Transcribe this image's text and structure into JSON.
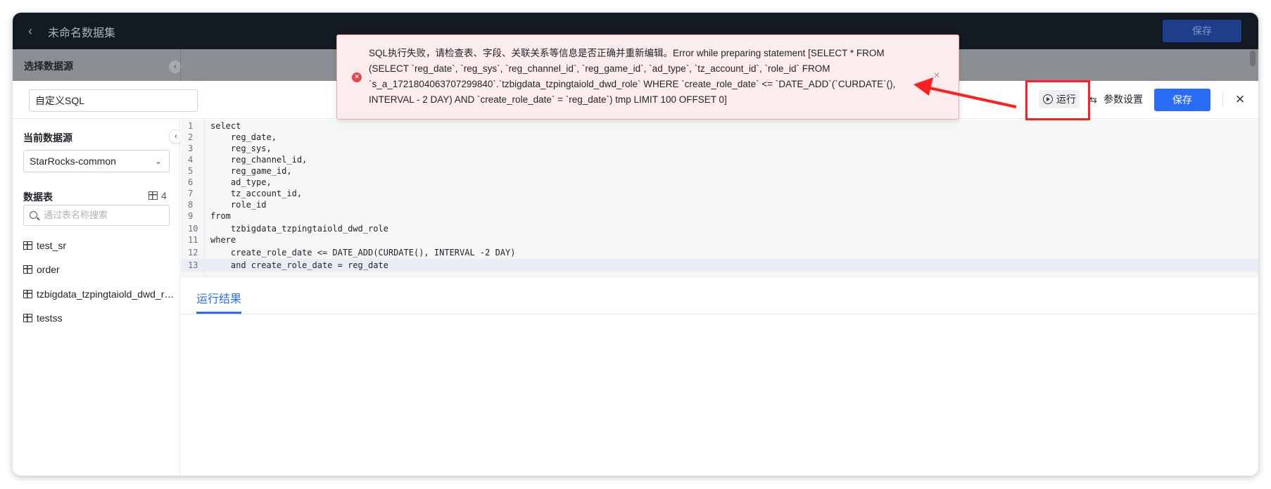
{
  "topbar": {
    "back_icon": "chevron-left-icon",
    "title": "未命名数据集",
    "save_label": "保存"
  },
  "background": {
    "select_source_label": "选择数据源"
  },
  "modal": {
    "dataset_name_value": "自定义SQL",
    "run_label": "运行",
    "params_label": "参数设置",
    "save_label": "保存",
    "close_icon": "close-icon"
  },
  "sidebar": {
    "current_source_label": "当前数据源",
    "source_value": "StarRocks-common",
    "tables_label": "数据表",
    "tables_count": "4",
    "search_placeholder": "通过表名称搜索",
    "tables": [
      {
        "name": "test_sr"
      },
      {
        "name": "order"
      },
      {
        "name": "tzbigdata_tzpingtaiold_dwd_role"
      },
      {
        "name": "testss"
      }
    ]
  },
  "editor": {
    "lines": [
      {
        "n": "1",
        "code": "select"
      },
      {
        "n": "2",
        "code": "    reg_date,"
      },
      {
        "n": "3",
        "code": "    reg_sys,"
      },
      {
        "n": "4",
        "code": "    reg_channel_id,"
      },
      {
        "n": "5",
        "code": "    reg_game_id,"
      },
      {
        "n": "6",
        "code": "    ad_type,"
      },
      {
        "n": "7",
        "code": "    tz_account_id,"
      },
      {
        "n": "8",
        "code": "    role_id"
      },
      {
        "n": "9",
        "code": "from"
      },
      {
        "n": "10",
        "code": "    tzbigdata_tzpingtaiold_dwd_role"
      },
      {
        "n": "11",
        "code": "where"
      },
      {
        "n": "12",
        "code": "    create_role_date <= DATE_ADD(CURDATE(), INTERVAL -2 DAY)"
      },
      {
        "n": "13",
        "code": "    and create_role_date = reg_date"
      }
    ],
    "active_line": 13
  },
  "results": {
    "tab_label": "运行结果"
  },
  "error_toast": {
    "message": "SQL执行失败，请检查表、字段、关联关系等信息是否正确并重新编辑。Error while preparing statement [SELECT * FROM (SELECT `reg_date`, `reg_sys`, `reg_channel_id`, `reg_game_id`, `ad_type`, `tz_account_id`, `role_id` FROM `s_a_1721804063707299840`.`tzbigdata_tzpingtaiold_dwd_role` WHERE `create_role_date` <= `DATE_ADD`(`CURDATE`(), INTERVAL - 2 DAY) AND `create_role_date` = `reg_date`) tmp LIMIT 100 OFFSET 0]",
    "icon": "error-circle-icon"
  },
  "colors": {
    "accent": "#2a6df5",
    "error": "#e5484d",
    "annotation": "#ff1f1f"
  }
}
